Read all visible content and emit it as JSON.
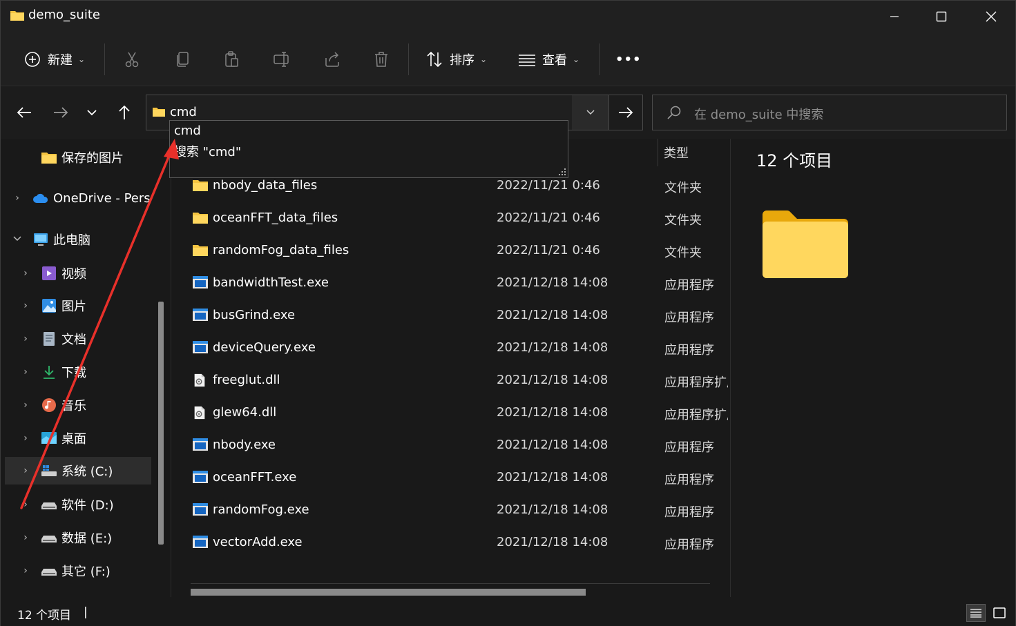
{
  "window": {
    "title": "demo_suite"
  },
  "toolbar": {
    "new_label": "新建",
    "sort_label": "排序",
    "view_label": "查看",
    "more_label": "•••"
  },
  "address": {
    "value": "cmd",
    "suggestions": [
      "cmd",
      "搜索 \"cmd\""
    ]
  },
  "search": {
    "placeholder": "在 demo_suite 中搜索"
  },
  "sidebar": {
    "items": [
      {
        "label": "保存的图片",
        "icon": "folder-icon"
      },
      {
        "label": "OneDrive - Personal",
        "icon": "cloud-icon"
      },
      {
        "label": "此电脑",
        "icon": "computer-icon"
      },
      {
        "label": "视频",
        "icon": "video-icon"
      },
      {
        "label": "图片",
        "icon": "pictures-icon"
      },
      {
        "label": "文档",
        "icon": "documents-icon"
      },
      {
        "label": "下载",
        "icon": "download-icon"
      },
      {
        "label": "音乐",
        "icon": "music-icon"
      },
      {
        "label": "桌面",
        "icon": "desktop-icon"
      },
      {
        "label": "系统 (C:)",
        "icon": "drive-c-icon"
      },
      {
        "label": "软件 (D:)",
        "icon": "drive-icon"
      },
      {
        "label": "数据 (E:)",
        "icon": "drive-icon"
      },
      {
        "label": "其它 (F:)",
        "icon": "drive-icon"
      }
    ]
  },
  "filelist": {
    "type_header": "类型",
    "files": [
      {
        "name": "nbody_data_files",
        "date": "2022/11/21 0:46",
        "type": "文件夹",
        "kind": "folder"
      },
      {
        "name": "oceanFFT_data_files",
        "date": "2022/11/21 0:46",
        "type": "文件夹",
        "kind": "folder"
      },
      {
        "name": "randomFog_data_files",
        "date": "2022/11/21 0:46",
        "type": "文件夹",
        "kind": "folder"
      },
      {
        "name": "bandwidthTest.exe",
        "date": "2021/12/18 14:08",
        "type": "应用程序",
        "kind": "exe"
      },
      {
        "name": "busGrind.exe",
        "date": "2021/12/18 14:08",
        "type": "应用程序",
        "kind": "exe"
      },
      {
        "name": "deviceQuery.exe",
        "date": "2021/12/18 14:08",
        "type": "应用程序",
        "kind": "exe"
      },
      {
        "name": "freeglut.dll",
        "date": "2021/12/18 14:08",
        "type": "应用程序扩展",
        "kind": "dll"
      },
      {
        "name": "glew64.dll",
        "date": "2021/12/18 14:08",
        "type": "应用程序扩展",
        "kind": "dll"
      },
      {
        "name": "nbody.exe",
        "date": "2021/12/18 14:08",
        "type": "应用程序",
        "kind": "exe"
      },
      {
        "name": "oceanFFT.exe",
        "date": "2021/12/18 14:08",
        "type": "应用程序",
        "kind": "exe"
      },
      {
        "name": "randomFog.exe",
        "date": "2021/12/18 14:08",
        "type": "应用程序",
        "kind": "exe"
      },
      {
        "name": "vectorAdd.exe",
        "date": "2021/12/18 14:08",
        "type": "应用程序",
        "kind": "exe"
      }
    ]
  },
  "preview": {
    "count_label": "12 个项目"
  },
  "status": {
    "count_label": "12 个项目",
    "cursor": "|"
  },
  "colors": {
    "accent": "#0078d4",
    "folder": "#f5c441",
    "annotation": "#e8302a"
  }
}
